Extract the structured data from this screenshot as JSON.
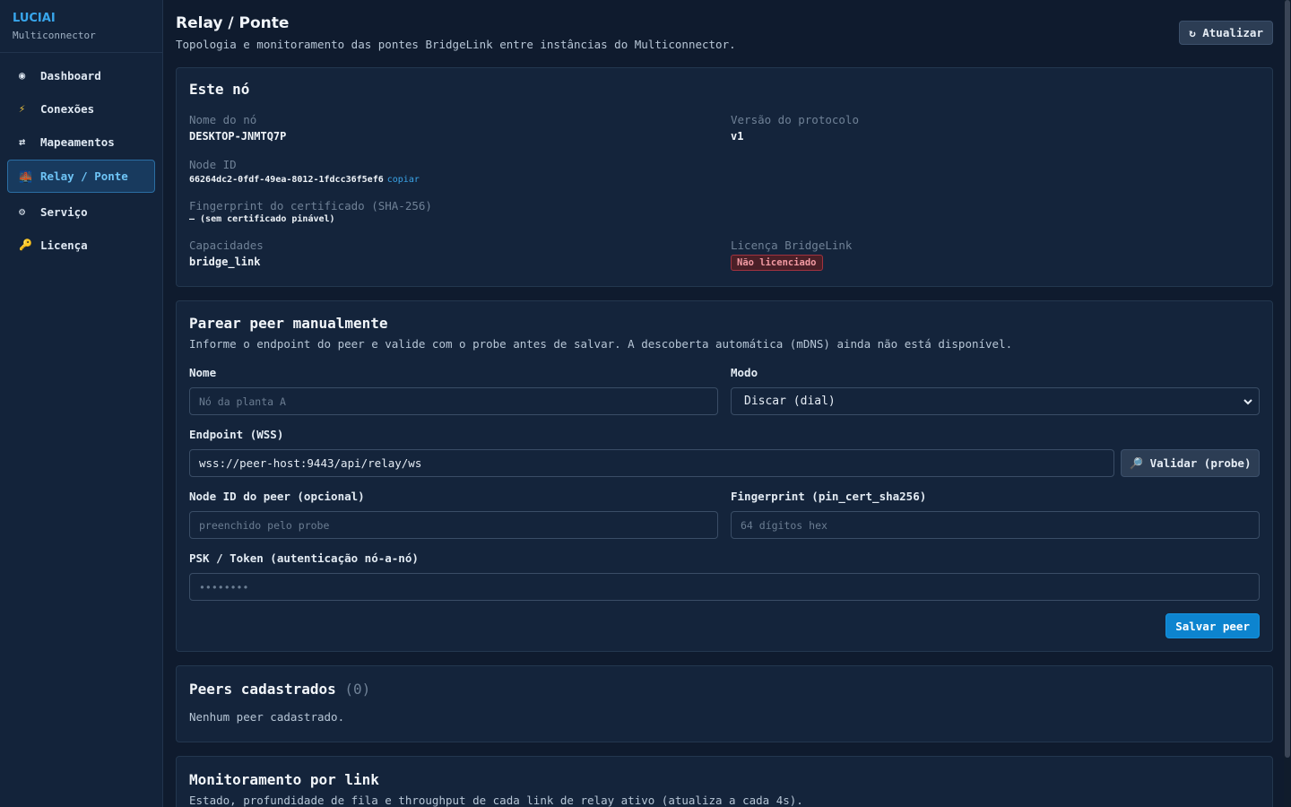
{
  "brand": {
    "title": "LUCIAI",
    "subtitle": "Multiconnector"
  },
  "sidebar": {
    "items": [
      {
        "icon": "◉",
        "label": "Dashboard"
      },
      {
        "icon": "⚡",
        "label": "Conexões"
      },
      {
        "icon": "⇄",
        "label": "Mapeamentos"
      },
      {
        "icon": "🌉",
        "label": "Relay / Ponte",
        "active": true
      },
      {
        "icon": "⚙",
        "label": "Serviço"
      },
      {
        "icon": "🔑",
        "label": "Licença"
      }
    ]
  },
  "header": {
    "title": "Relay / Ponte",
    "subtitle": "Topologia e monitoramento das pontes BridgeLink entre instâncias do Multiconnector.",
    "refresh_label": "↻ Atualizar"
  },
  "node": {
    "title": "Este nó",
    "name_label": "Nome do nó",
    "name_value": "DESKTOP-JNMTQ7P",
    "protocol_label": "Versão do protocolo",
    "protocol_value": "v1",
    "node_id_label": "Node ID",
    "node_id_value": "66264dc2-0fdf-49ea-8012-1fdcc36f5ef6",
    "copy_label": "copiar",
    "fingerprint_label": "Fingerprint do certificado (SHA-256)",
    "fingerprint_value": "— (sem certificado pinável)",
    "capabilities_label": "Capacidades",
    "capabilities_value": "bridge_link",
    "license_label": "Licença BridgeLink",
    "license_badge": "Não licenciado"
  },
  "pair": {
    "title": "Parear peer manualmente",
    "description": "Informe o endpoint do peer e valide com o probe antes de salvar. A descoberta automática (mDNS) ainda não está disponível.",
    "name_label": "Nome",
    "name_placeholder": "Nó da planta A",
    "mode_label": "Modo",
    "mode_value": "Discar (dial)",
    "endpoint_label": "Endpoint (WSS)",
    "endpoint_value": "wss://peer-host:9443/api/relay/ws",
    "probe_label": "🔎 Validar (probe)",
    "peer_node_label": "Node ID do peer (opcional)",
    "peer_node_placeholder": "preenchido pelo probe",
    "fingerprint_label": "Fingerprint (pin_cert_sha256)",
    "fingerprint_placeholder": "64 dígitos hex",
    "psk_label": "PSK / Token (autenticação nó-a-nó)",
    "psk_placeholder": "••••••••",
    "save_label": "Salvar peer"
  },
  "peers": {
    "title": "Peers cadastrados",
    "count": "(0)",
    "empty": "Nenhum peer cadastrado."
  },
  "monitor": {
    "title": "Monitoramento por link",
    "description": "Estado, profundidade de fila e throughput de cada link de relay ativo (atualiza a cada 4s)."
  }
}
